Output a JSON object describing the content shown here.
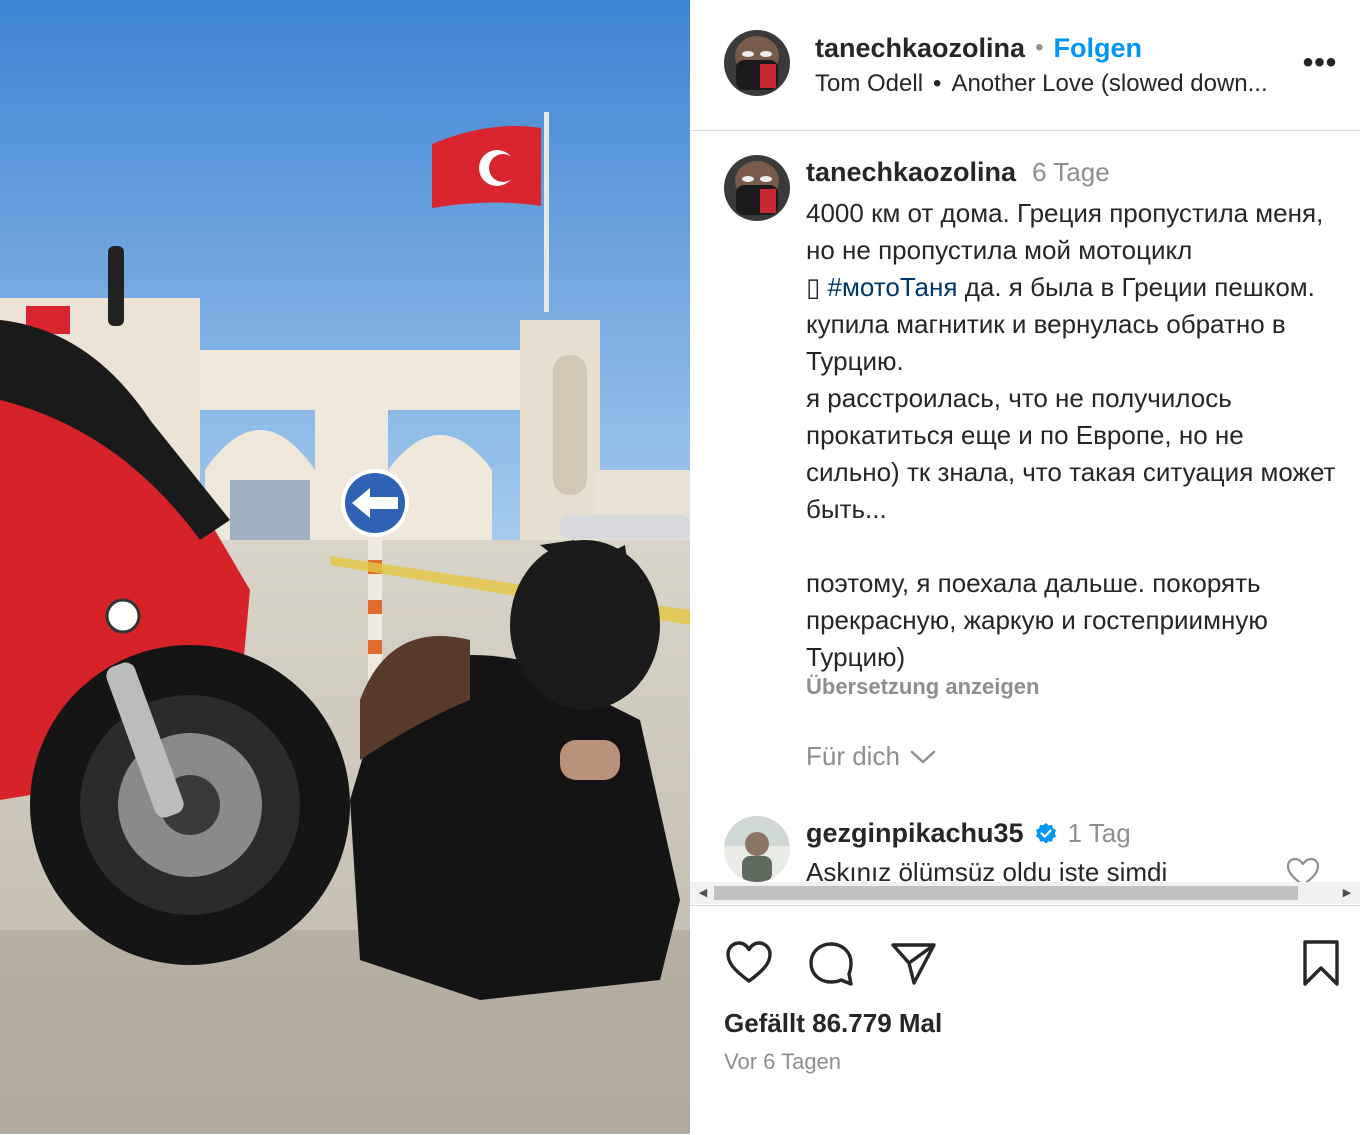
{
  "post": {
    "author": "tanechkaozolina",
    "follow_label": "Folgen",
    "separator": "•",
    "audio_artist": "Tom Odell",
    "audio_title": "Another Love (slowed down...",
    "more_label": "•••"
  },
  "caption": {
    "author": "tanechkaozolina",
    "age": "6 Tage",
    "line1": "4000 км от дома. Греция пропустила меня, но не пропустила мой мотоцикл",
    "emoji_placeholder": "▯",
    "hashtag": "#мотоТаня",
    "line1_after": "да. я была в Греции пешком. купила магнитик и вернулась обратно в Турцию.",
    "line2": "я расстроилась, что не получилось прокатиться еще и по Европе, но не сильно) тк знала, что такая ситуация может быть...",
    "line3": "поэтому, я поехала дальше. покорять прекрасную, жаркую и гостеприимную Турцию)",
    "translate_label": "Übersetzung anzeigen",
    "for_you_label": "Für dich"
  },
  "comment": {
    "author": "gezginpikachu35",
    "age": "1 Tag",
    "text": "Askınız ölümsüz oldu iste simdi"
  },
  "footer": {
    "likes": "Gefällt 86.779 Mal",
    "posted": "Vor 6 Tagen"
  },
  "icons": {
    "like": "heart-icon",
    "comment": "comment-icon",
    "share": "send-icon",
    "save": "bookmark-icon",
    "verified": "verified-badge-icon"
  },
  "colors": {
    "link": "#0095f6",
    "hashtag": "#00376b",
    "muted": "#8e8e8e",
    "text": "#262626",
    "verified": "#0095f6"
  }
}
